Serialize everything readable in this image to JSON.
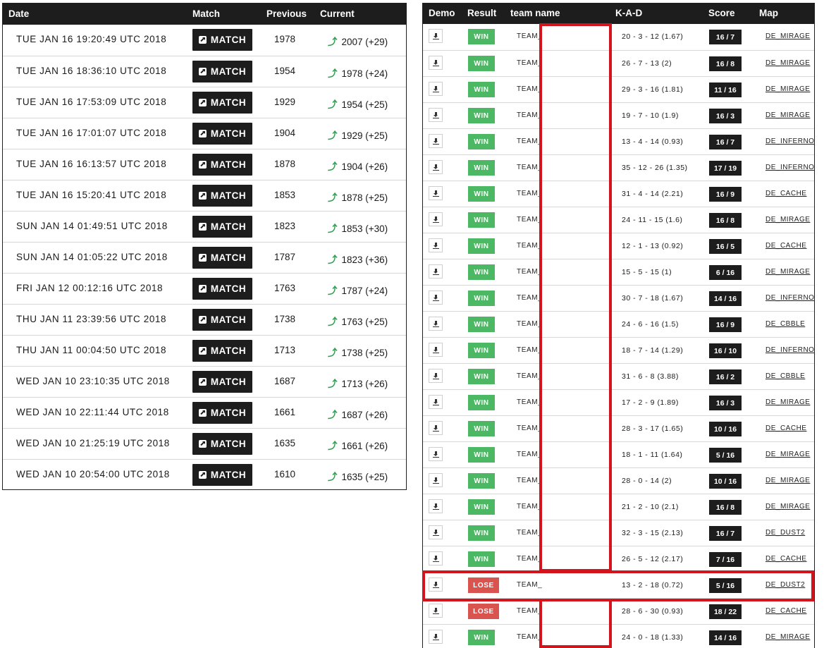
{
  "left_table": {
    "headers": {
      "date": "Date",
      "match": "Match",
      "previous": "Previous",
      "current": "Current"
    },
    "match_label": "MATCH",
    "rows": [
      {
        "date": "TUE JAN 16 19:20:49 UTC 2018",
        "previous": "1978",
        "current": "2007 (+29)"
      },
      {
        "date": "TUE JAN 16 18:36:10 UTC 2018",
        "previous": "1954",
        "current": "1978 (+24)"
      },
      {
        "date": "TUE JAN 16 17:53:09 UTC 2018",
        "previous": "1929",
        "current": "1954 (+25)"
      },
      {
        "date": "TUE JAN 16 17:01:07 UTC 2018",
        "previous": "1904",
        "current": "1929 (+25)"
      },
      {
        "date": "TUE JAN 16 16:13:57 UTC 2018",
        "previous": "1878",
        "current": "1904 (+26)"
      },
      {
        "date": "TUE JAN 16 15:20:41 UTC 2018",
        "previous": "1853",
        "current": "1878 (+25)"
      },
      {
        "date": "SUN JAN 14 01:49:51 UTC 2018",
        "previous": "1823",
        "current": "1853 (+30)"
      },
      {
        "date": "SUN JAN 14 01:05:22 UTC 2018",
        "previous": "1787",
        "current": "1823 (+36)"
      },
      {
        "date": "FRI JAN 12 00:12:16 UTC 2018",
        "previous": "1763",
        "current": "1787 (+24)"
      },
      {
        "date": "THU JAN 11 23:39:56 UTC 2018",
        "previous": "1738",
        "current": "1763 (+25)"
      },
      {
        "date": "THU JAN 11 00:04:50 UTC 2018",
        "previous": "1713",
        "current": "1738 (+25)"
      },
      {
        "date": "WED JAN 10 23:10:35 UTC 2018",
        "previous": "1687",
        "current": "1713 (+26)"
      },
      {
        "date": "WED JAN 10 22:11:44 UTC 2018",
        "previous": "1661",
        "current": "1687 (+26)"
      },
      {
        "date": "WED JAN 10 21:25:19 UTC 2018",
        "previous": "1635",
        "current": "1661 (+26)"
      },
      {
        "date": "WED JAN 10 20:54:00 UTC 2018",
        "previous": "1610",
        "current": "1635 (+25)"
      }
    ]
  },
  "right_table": {
    "headers": {
      "demo": "Demo",
      "result": "Result",
      "team": "team name",
      "kad": "K-A-D",
      "score": "Score",
      "map": "Map"
    },
    "team_label": "TEAM_",
    "rows": [
      {
        "result": "WIN",
        "kad": "20 - 3 - 12 (1.67)",
        "score": "16 / 7",
        "map": "DE_MIRAGE"
      },
      {
        "result": "WIN",
        "kad": "26 - 7 - 13 (2)",
        "score": "16 / 8",
        "map": "DE_MIRAGE"
      },
      {
        "result": "WIN",
        "kad": "29 - 3 - 16 (1.81)",
        "score": "11 / 16",
        "map": "DE_MIRAGE"
      },
      {
        "result": "WIN",
        "kad": "19 - 7 - 10 (1.9)",
        "score": "16 / 3",
        "map": "DE_MIRAGE"
      },
      {
        "result": "WIN",
        "kad": "13 - 4 - 14 (0.93)",
        "score": "16 / 7",
        "map": "DE_INFERNO"
      },
      {
        "result": "WIN",
        "kad": "35 - 12 - 26 (1.35)",
        "score": "17 / 19",
        "map": "DE_INFERNO"
      },
      {
        "result": "WIN",
        "kad": "31 - 4 - 14 (2.21)",
        "score": "16 / 9",
        "map": "DE_CACHE"
      },
      {
        "result": "WIN",
        "kad": "24 - 11 - 15 (1.6)",
        "score": "16 / 8",
        "map": "DE_MIRAGE"
      },
      {
        "result": "WIN",
        "kad": "12 - 1 - 13 (0.92)",
        "score": "16 / 5",
        "map": "DE_CACHE"
      },
      {
        "result": "WIN",
        "kad": "15 - 5 - 15 (1)",
        "score": "6 / 16",
        "map": "DE_MIRAGE"
      },
      {
        "result": "WIN",
        "kad": "30 - 7 - 18 (1.67)",
        "score": "14 / 16",
        "map": "DE_INFERNO"
      },
      {
        "result": "WIN",
        "kad": "24 - 6 - 16 (1.5)",
        "score": "16 / 9",
        "map": "DE_CBBLE"
      },
      {
        "result": "WIN",
        "kad": "18 - 7 - 14 (1.29)",
        "score": "16 / 10",
        "map": "DE_INFERNO"
      },
      {
        "result": "WIN",
        "kad": "31 - 6 - 8 (3.88)",
        "score": "16 / 2",
        "map": "DE_CBBLE"
      },
      {
        "result": "WIN",
        "kad": "17 - 2 - 9 (1.89)",
        "score": "16 / 3",
        "map": "DE_MIRAGE"
      },
      {
        "result": "WIN",
        "kad": "28 - 3 - 17 (1.65)",
        "score": "10 / 16",
        "map": "DE_CACHE"
      },
      {
        "result": "WIN",
        "kad": "18 - 1 - 11 (1.64)",
        "score": "5 / 16",
        "map": "DE_MIRAGE"
      },
      {
        "result": "WIN",
        "kad": "28 - 0 - 14 (2)",
        "score": "10 / 16",
        "map": "DE_MIRAGE"
      },
      {
        "result": "WIN",
        "kad": "21 - 2 - 10 (2.1)",
        "score": "16 / 8",
        "map": "DE_MIRAGE"
      },
      {
        "result": "WIN",
        "kad": "32 - 3 - 15 (2.13)",
        "score": "16 / 7",
        "map": "DE_DUST2"
      },
      {
        "result": "WIN",
        "kad": "26 - 5 - 12 (2.17)",
        "score": "7 / 16",
        "map": "DE_CACHE"
      },
      {
        "result": "LOSE",
        "kad": "13 - 2 - 18 (0.72)",
        "score": "5 / 16",
        "map": "DE_DUST2"
      },
      {
        "result": "LOSE",
        "kad": "28 - 6 - 30 (0.93)",
        "score": "18 / 22",
        "map": "DE_CACHE"
      },
      {
        "result": "WIN",
        "kad": "24 - 0 - 18 (1.33)",
        "score": "14 / 16",
        "map": "DE_MIRAGE"
      }
    ]
  },
  "colors": {
    "header_bg": "#1d1d1d",
    "win": "#4cb863",
    "lose": "#d9534f",
    "up_arrow": "#2e9e4f",
    "annotation": "#d4141c"
  },
  "icons": {
    "match": "external-link-icon",
    "demo": "download-icon",
    "trend": "arrow-up-icon"
  }
}
